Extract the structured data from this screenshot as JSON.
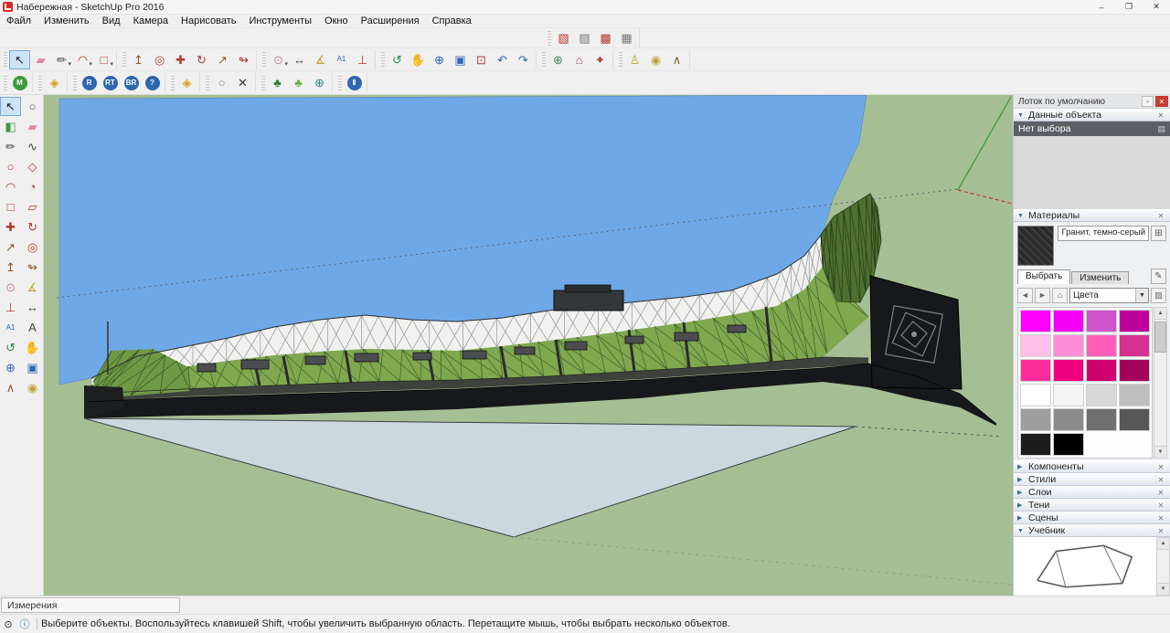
{
  "window": {
    "title": "Набережная - SketchUp Pro 2016",
    "controls": {
      "minimize": "–",
      "maximize": "❐",
      "close": "✕"
    }
  },
  "menu": {
    "items": [
      "Файл",
      "Изменить",
      "Вид",
      "Камера",
      "Нарисовать",
      "Инструменты",
      "Окно",
      "Расширения",
      "Справка"
    ]
  },
  "toolbars": {
    "floating": [
      {
        "n": "section-plane-tool",
        "t": "▧",
        "c": "#b33a2e"
      },
      {
        "n": "section-display-toggle",
        "t": "▨",
        "c": "#777777"
      },
      {
        "n": "section-cut-toggle",
        "t": "▩",
        "c": "#b33a2e"
      },
      {
        "n": "section-fill-toggle",
        "t": "▦",
        "c": "#777777"
      }
    ],
    "main": [
      [
        {
          "n": "select-tool",
          "t": "↖",
          "c": "#1a1a1a",
          "pressed": true
        },
        {
          "n": "eraser-tool",
          "t": "▰",
          "c": "#d98ba6"
        },
        {
          "n": "line-tool",
          "t": "✏",
          "c": "#444444",
          "dd": true
        },
        {
          "n": "arc-tool",
          "t": "◠",
          "c": "#b33a2e",
          "dd": true
        },
        {
          "n": "rectangle-tool",
          "t": "□",
          "c": "#b33a2e",
          "dd": true
        }
      ],
      [
        {
          "n": "pushpull-tool",
          "t": "↥",
          "c": "#8a5a2a"
        },
        {
          "n": "offset-tool",
          "t": "◎",
          "c": "#b33a2e"
        },
        {
          "n": "move-tool",
          "t": "✚",
          "c": "#b33a2e"
        },
        {
          "n": "rotate-tool",
          "t": "↻",
          "c": "#b33a2e"
        },
        {
          "n": "scale-tool",
          "t": "↗",
          "c": "#8a5a2a"
        },
        {
          "n": "followme-tool",
          "t": "↬",
          "c": "#b33a2e"
        }
      ],
      [
        {
          "n": "tape-measure-tool",
          "t": "⊙",
          "c": "#c87fa0",
          "dd": true
        },
        {
          "n": "dimension-tool",
          "t": "↔",
          "c": "#444444"
        },
        {
          "n": "protractor-tool",
          "t": "∡",
          "c": "#c2a23c"
        },
        {
          "n": "text-tool",
          "t": "A1",
          "c": "#2e66b0",
          "fs": 8
        },
        {
          "n": "axes-tool",
          "t": "⊥",
          "c": "#b33a2e"
        }
      ],
      [
        {
          "n": "orbit-tool",
          "t": "↺",
          "c": "#1f8f4d"
        },
        {
          "n": "pan-tool",
          "t": "✋",
          "c": "#d0a96a"
        },
        {
          "n": "zoom-tool",
          "t": "⊕",
          "c": "#2e66b0"
        },
        {
          "n": "zoom-window-tool",
          "t": "▣",
          "c": "#2e66b0"
        },
        {
          "n": "zoom-extents-tool",
          "t": "⊡",
          "c": "#b33a2e"
        },
        {
          "n": "previous-view-tool",
          "t": "↶",
          "c": "#2e66b0"
        },
        {
          "n": "next-view-tool",
          "t": "↷",
          "c": "#2e66b0"
        }
      ],
      [
        {
          "n": "add-location-tool",
          "t": "⊕",
          "c": "#3a8f5f"
        },
        {
          "n": "warehouse-3d-tool",
          "t": "⌂",
          "c": "#b33a2e"
        },
        {
          "n": "extension-warehouse-tool",
          "t": "✦",
          "c": "#b33a2e"
        }
      ],
      [
        {
          "n": "position-camera-tool",
          "t": "♙",
          "c": "#c2a23c"
        },
        {
          "n": "look-around-tool",
          "t": "◉",
          "c": "#c2a23c"
        },
        {
          "n": "walk-tool",
          "t": "∧",
          "c": "#8a5a2a"
        }
      ]
    ],
    "plugins": [
      [
        {
          "n": "material-plugin-tool",
          "t": "M",
          "bg": "#3a9d3a"
        }
      ],
      [
        {
          "n": "tag-tool",
          "t": "◈",
          "c": "#d4a017"
        }
      ],
      [
        {
          "n": "render-r-tool",
          "t": "R",
          "bg": "#2e66b0"
        },
        {
          "n": "render-rt-tool",
          "t": "RT",
          "bg": "#2e66b0"
        },
        {
          "n": "render-br-tool",
          "t": "BR",
          "bg": "#2e66b0"
        },
        {
          "n": "plugin-help-tool",
          "t": "?",
          "bg": "#2e66b0"
        }
      ],
      [
        {
          "n": "tag2-tool",
          "t": "◈",
          "c": "#d4a017"
        }
      ],
      [
        {
          "n": "oval-tool",
          "t": "○",
          "c": "#888888"
        },
        {
          "n": "scatter-tool",
          "t": "✕",
          "c": "#333333"
        }
      ],
      [
        {
          "n": "tree-tool",
          "t": "♣",
          "c": "#2f7d32"
        },
        {
          "n": "tree-sparkle-tool",
          "t": "♣",
          "c": "#6db04a"
        },
        {
          "n": "globe-tool",
          "t": "⊕",
          "c": "#2e8b8b"
        }
      ],
      [
        {
          "n": "pause-tool",
          "t": "Ⅱ",
          "bg": "#2e66b0"
        }
      ]
    ],
    "left": [
      {
        "n": "select-tool",
        "t": "↖",
        "c": "#1a1a1a",
        "pressed": true
      },
      {
        "n": "lasso-tool",
        "t": "○",
        "c": "#555555"
      },
      {
        "n": "paint-bucket-tool",
        "t": "◧",
        "c": "#3a9d3a"
      },
      {
        "n": "eraser-tool",
        "t": "▰",
        "c": "#d98ba6"
      },
      {
        "n": "pencil-tool",
        "t": "✏",
        "c": "#444444"
      },
      {
        "n": "freehand-tool",
        "t": "∿",
        "c": "#444444"
      },
      {
        "n": "circle-tool",
        "t": "○",
        "c": "#b33a2e"
      },
      {
        "n": "polygon-tool",
        "t": "◇",
        "c": "#b33a2e"
      },
      {
        "n": "arc-tool",
        "t": "◠",
        "c": "#b33a2e"
      },
      {
        "n": "pie-tool",
        "t": "◔",
        "c": "#b33a2e"
      },
      {
        "n": "rectangle-tool",
        "t": "□",
        "c": "#b33a2e"
      },
      {
        "n": "rotated-rectangle-tool",
        "t": "▱",
        "c": "#b33a2e"
      },
      {
        "n": "move-tool",
        "t": "✚",
        "c": "#b33a2e"
      },
      {
        "n": "rotate-tool",
        "t": "↻",
        "c": "#b33a2e"
      },
      {
        "n": "scale-tool",
        "t": "↗",
        "c": "#8a5a2a"
      },
      {
        "n": "offset-tool",
        "t": "◎",
        "c": "#b33a2e"
      },
      {
        "n": "pushpull-tool",
        "t": "↥",
        "c": "#8a5a2a"
      },
      {
        "n": "followme-tool",
        "t": "↬",
        "c": "#8a5a2a"
      },
      {
        "n": "tape-measure-tool",
        "t": "⊙",
        "c": "#c87fa0"
      },
      {
        "n": "protractor-tool",
        "t": "∡",
        "c": "#c2a23c"
      },
      {
        "n": "axes-tool",
        "t": "⊥",
        "c": "#b33a2e"
      },
      {
        "n": "dimension-tool",
        "t": "↔",
        "c": "#444444"
      },
      {
        "n": "text-tool",
        "t": "A1",
        "c": "#2e66b0",
        "fs": 8
      },
      {
        "n": "text-3d-tool",
        "t": "A",
        "c": "#444444"
      },
      {
        "n": "orbit-tool",
        "t": "↺",
        "c": "#1f8f4d"
      },
      {
        "n": "pan-tool",
        "t": "✋",
        "c": "#d0a96a"
      },
      {
        "n": "zoom-tool",
        "t": "⊕",
        "c": "#2e66b0"
      },
      {
        "n": "zoom-window-tool",
        "t": "▣",
        "c": "#2e66b0"
      },
      {
        "n": "walk-tool",
        "t": "∧",
        "c": "#8a5a2a"
      },
      {
        "n": "look-around-tool",
        "t": "◉",
        "c": "#c2a23c"
      }
    ]
  },
  "viewport": {
    "colors": {
      "sky": "#6FA8E6",
      "ground": "#A6BE94",
      "water": "#CBD9DE",
      "terrain_green": "#7FA84F",
      "terrain_green_dark": "#4e7030",
      "terrain_white": "#F1F1EF",
      "structure_dark": "#16191b"
    }
  },
  "tray": {
    "title": "Лоток по умолчанию",
    "entity": {
      "label": "Данные объекта",
      "status": "Нет выбора"
    },
    "materials": {
      "label": "Материалы",
      "material_name": "Гранит, темно-серый",
      "tabs": [
        "Выбрать",
        "Изменить"
      ],
      "collection": "Цвета",
      "palette": [
        [
          "#FF00FF",
          "#F400F4",
          "#CC55CC",
          "#C0009C"
        ],
        [
          "#FFC0E8",
          "#FF8ED6",
          "#FF5FB8",
          "#D6308F"
        ],
        [
          "#FF2D9B",
          "#F1007D",
          "#D10070",
          "#A3005C"
        ],
        [
          "#FFFFFF",
          "#F5F5F5",
          "#D8D8D8",
          "#BFBFBF"
        ],
        [
          "#9E9E9E",
          "#8C8C8C",
          "#6F6F6F",
          "#575757"
        ],
        [
          "#1C1C1C",
          "#000000"
        ]
      ]
    },
    "sections": [
      "Компоненты",
      "Стили",
      "Слои",
      "Тени",
      "Сцены"
    ],
    "instructor": {
      "label": "Учебник"
    }
  },
  "measurements": {
    "label": "Измерения"
  },
  "status": {
    "text": "Выберите объекты. Воспользуйтесь клавишей Shift, чтобы увеличить выбранную область. Перетащите мышь, чтобы выбрать несколько объектов."
  }
}
